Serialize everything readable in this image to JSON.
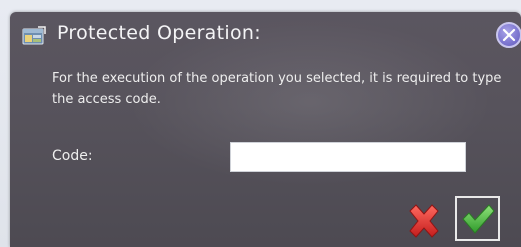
{
  "dialog": {
    "title": "Protected Operation:",
    "message": "For the execution of the operation you selected, it is required to type the access code.",
    "code_label": "Code:",
    "code_value": "",
    "icons": {
      "app": "app-window-icon",
      "close": "close-icon",
      "cancel": "red-x-icon",
      "confirm": "green-checkmark-icon"
    },
    "colors": {
      "background": "#57535c",
      "text": "#f2f2f2",
      "close_accent": "#7c75cf",
      "cancel_red": "#e03434",
      "confirm_green": "#4cb843"
    }
  }
}
